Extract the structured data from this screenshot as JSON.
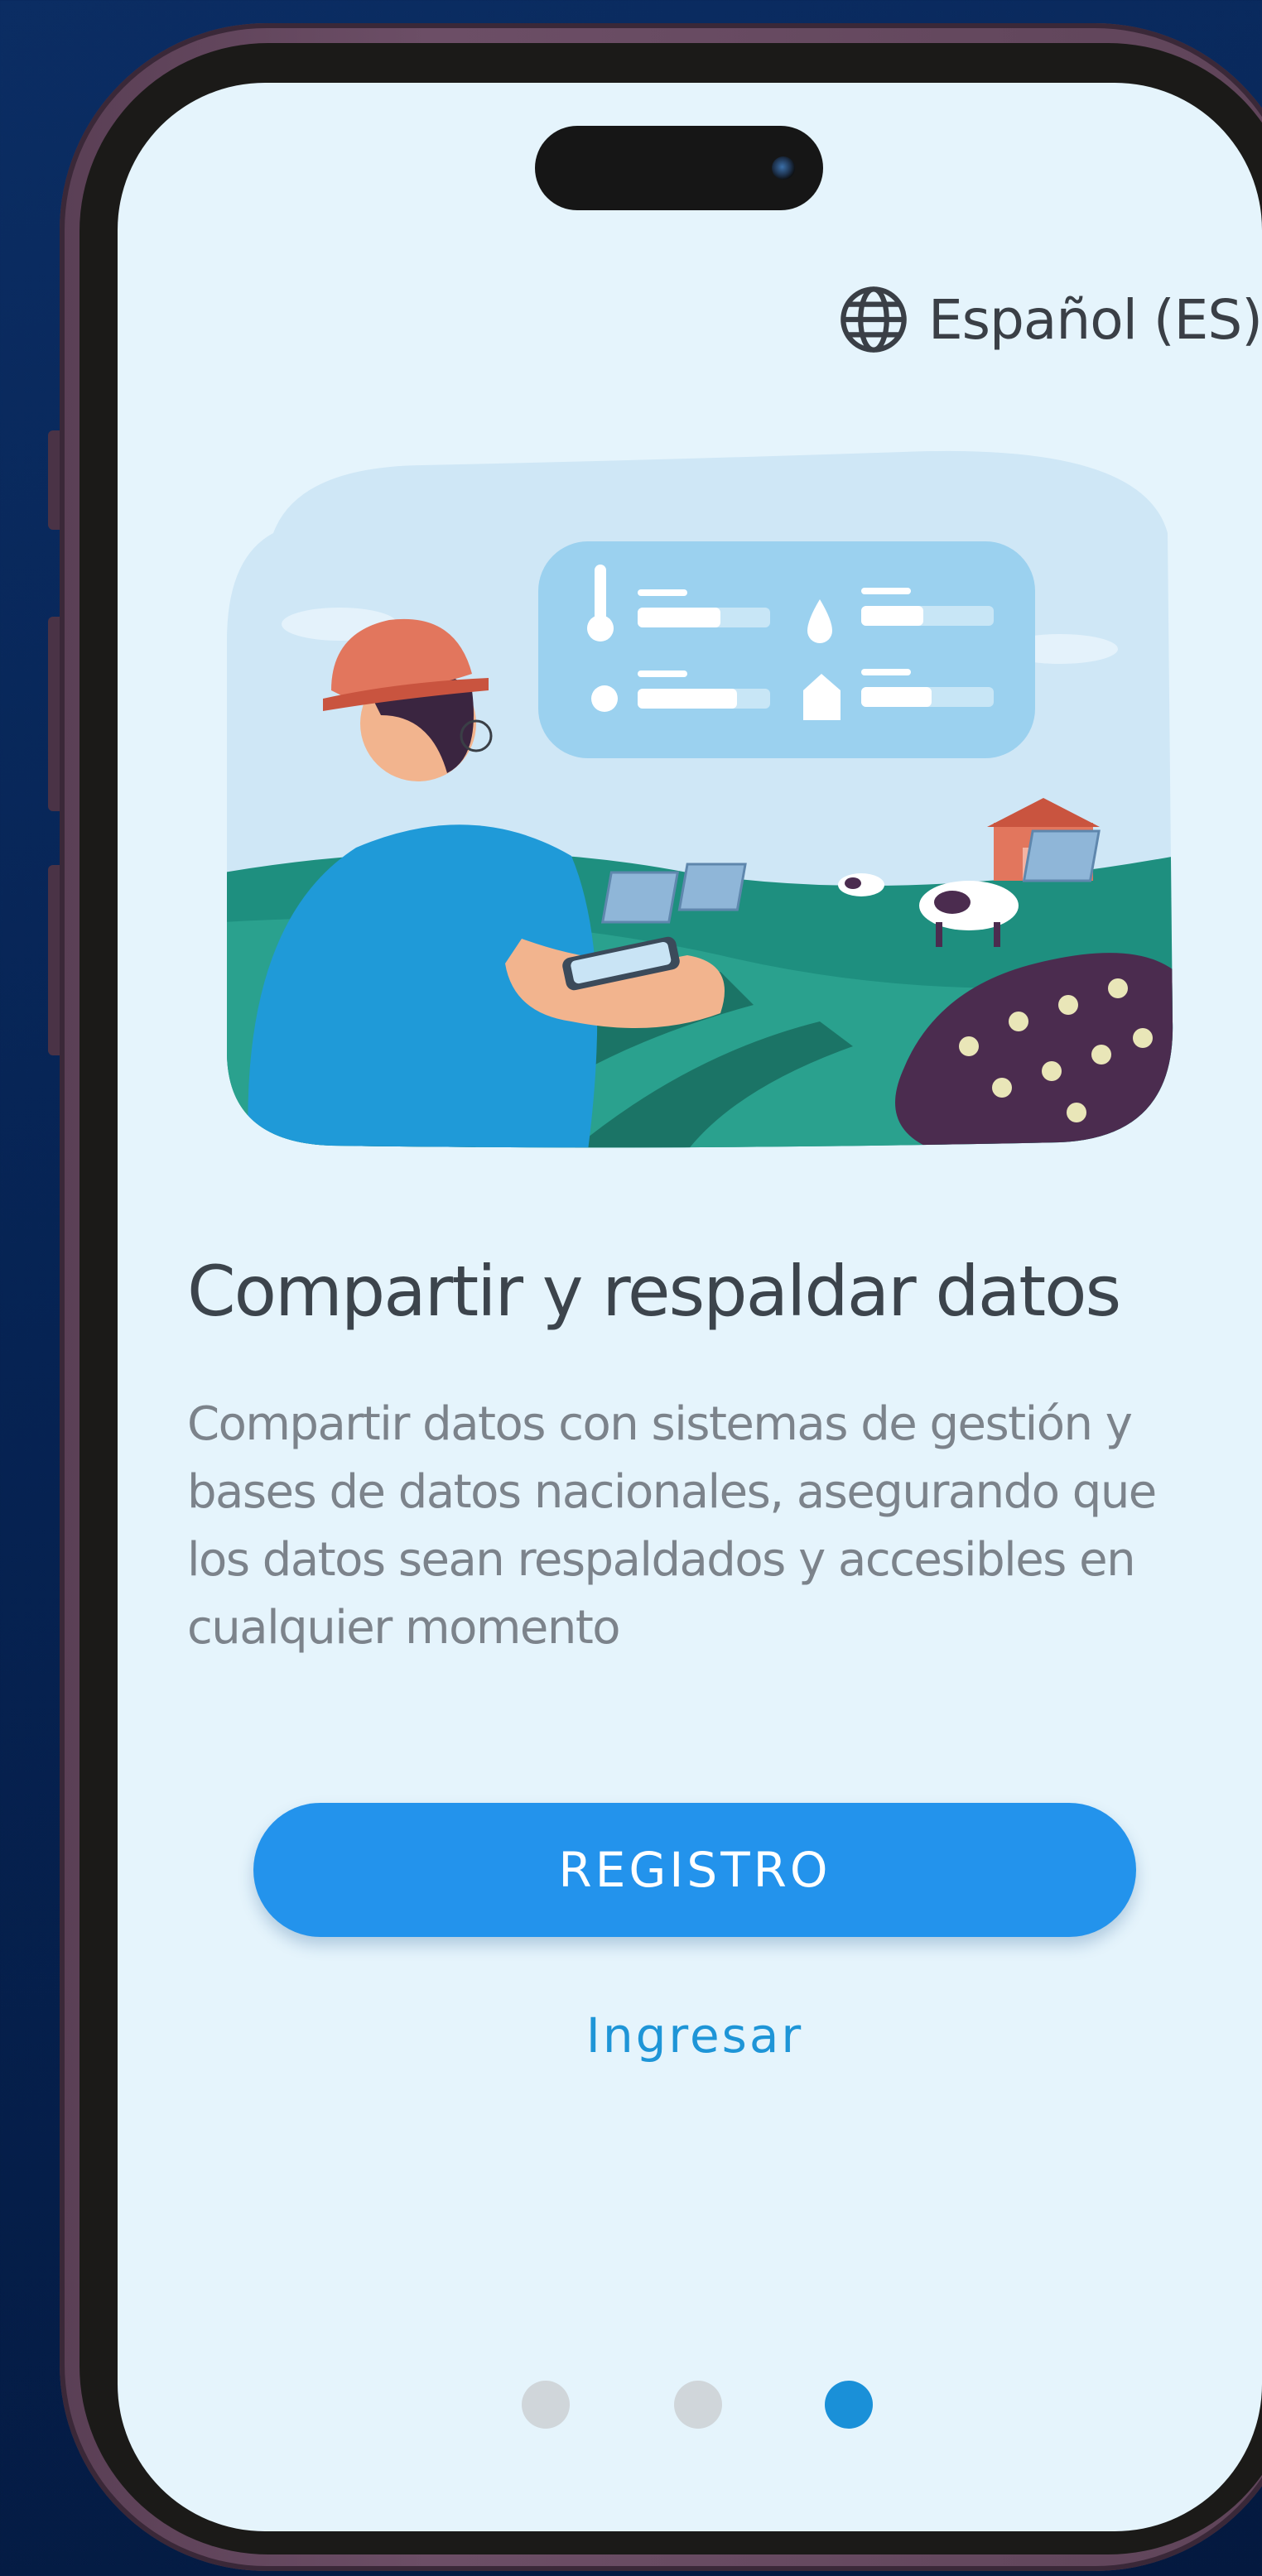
{
  "language_selector": {
    "icon": "globe-icon",
    "label": "Español (ES)"
  },
  "onboarding": {
    "title": "Compartir y respaldar datos",
    "description": "Compartir datos con sistemas de gestión y bases de datos nacionales, asegurando que los datos sean respaldados y accesibles en cualquier momento",
    "register_label": "REGISTRO",
    "login_label": "Ingresar",
    "illustration_icons": [
      "thermometer-icon",
      "water-drop-icon",
      "sun-icon",
      "crop-chart-icon"
    ]
  },
  "pagination": {
    "total": 3,
    "active_index": 2
  },
  "colors": {
    "screen_background": "#e5f4fc",
    "primary_button": "#2393ec",
    "link": "#1e95d7",
    "active_dot": "#1a90d8",
    "inactive_dot": "#d0d6da"
  }
}
